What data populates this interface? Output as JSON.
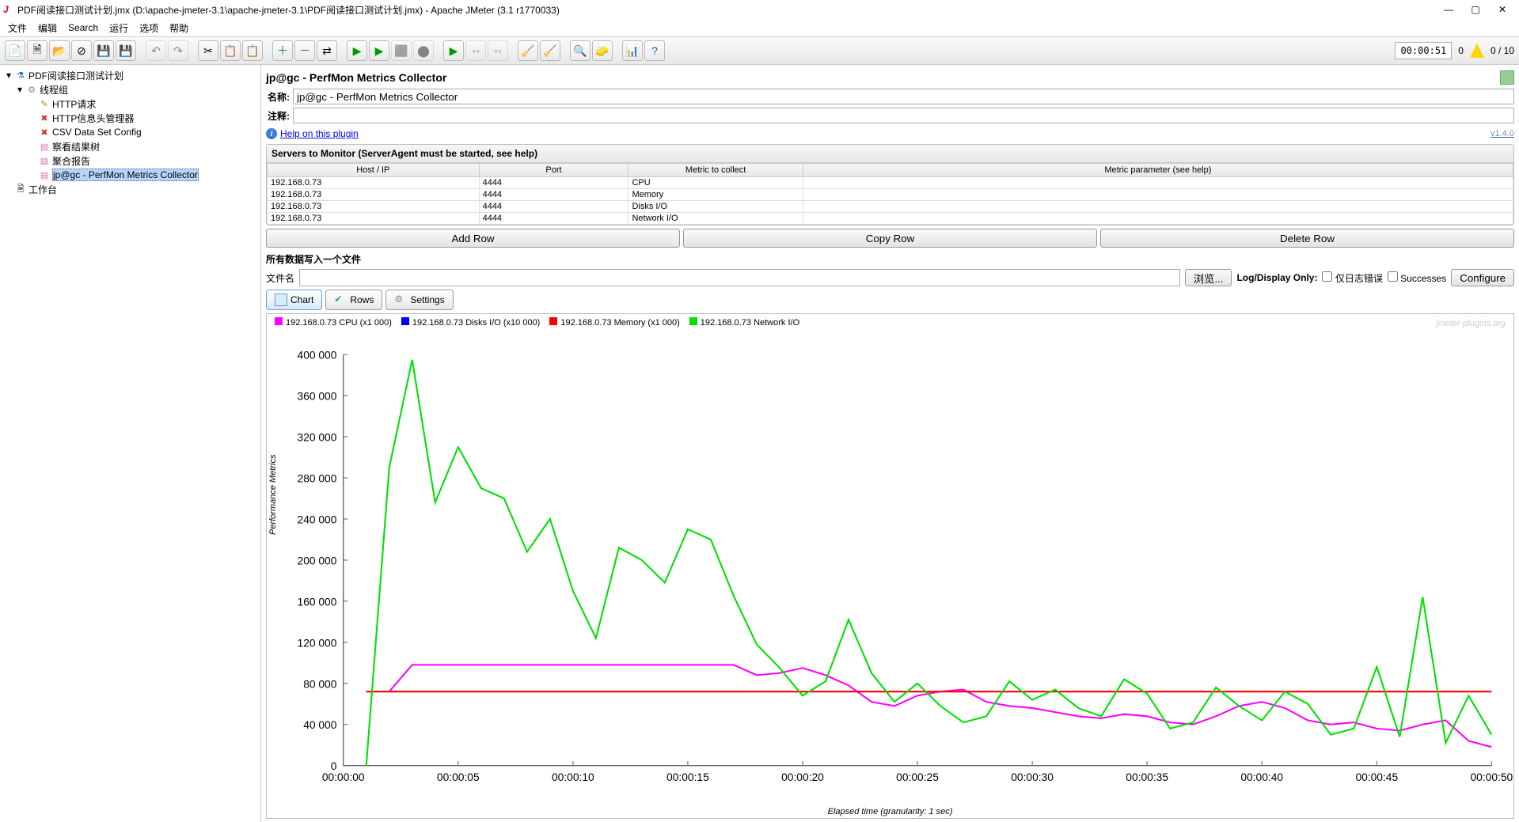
{
  "window": {
    "title": "PDF阅读接口测试计划.jmx (D:\\apache-jmeter-3.1\\apache-jmeter-3.1\\PDF阅读接口测试计划.jmx) - Apache JMeter (3.1 r1770033)"
  },
  "menubar": [
    "文件",
    "编辑",
    "Search",
    "运行",
    "选项",
    "帮助"
  ],
  "toolbar_right": {
    "timer": "00:00:51",
    "warn_count": "0",
    "threads": "0 / 10"
  },
  "tree": {
    "root": "PDF阅读接口测试计划",
    "threadgroup": "线程组",
    "items": [
      "HTTP请求",
      "HTTP信息头管理器",
      "CSV Data Set Config",
      "察看结果树",
      "聚合报告",
      "jp@gc - PerfMon Metrics Collector"
    ],
    "workbench": "工作台"
  },
  "page": {
    "title": "jp@gc - PerfMon Metrics Collector",
    "name_label": "名称:",
    "name_value": "jp@gc - PerfMon Metrics Collector",
    "comment_label": "注释:",
    "help_link": "Help on this plugin",
    "version": "v1.4.0"
  },
  "servers_panel": {
    "title": "Servers to Monitor (ServerAgent must be started, see help)",
    "columns": [
      "Host / IP",
      "Port",
      "Metric to collect",
      "Metric parameter (see help)"
    ],
    "rows": [
      {
        "host": "192.168.0.73",
        "port": "4444",
        "metric": "CPU",
        "param": ""
      },
      {
        "host": "192.168.0.73",
        "port": "4444",
        "metric": "Memory",
        "param": ""
      },
      {
        "host": "192.168.0.73",
        "port": "4444",
        "metric": "Disks I/O",
        "param": ""
      },
      {
        "host": "192.168.0.73",
        "port": "4444",
        "metric": "Network I/O",
        "param": ""
      }
    ],
    "buttons": {
      "add": "Add Row",
      "copy": "Copy Row",
      "delete": "Delete Row"
    }
  },
  "file_section": {
    "heading": "所有数据写入一个文件",
    "label": "文件名",
    "browse": "浏览...",
    "logonly": "Log/Display Only:",
    "errors": "仅日志错误",
    "successes": "Successes",
    "configure": "Configure"
  },
  "tabs": {
    "chart": "Chart",
    "rows": "Rows",
    "settings": "Settings"
  },
  "legend": [
    {
      "color": "#ff00ff",
      "label": "192.168.0.73 CPU (x1 000)"
    },
    {
      "color": "#0000ff",
      "label": "192.168.0.73 Disks I/O (x10 000)"
    },
    {
      "color": "#ff0000",
      "label": "192.168.0.73 Memory (x1 000)"
    },
    {
      "color": "#00e000",
      "label": "192.168.0.73 Network I/O"
    }
  ],
  "watermark": "jmeter-plugins.org",
  "axis": {
    "ylabel": "Performance Metrics",
    "xlabel": "Elapsed time (granularity: 1 sec)",
    "yticks": [
      "0",
      "40 000",
      "80 000",
      "120 000",
      "160 000",
      "200 000",
      "240 000",
      "280 000",
      "320 000",
      "360 000",
      "400 000"
    ],
    "xticks": [
      "00:00:00",
      "00:00:05",
      "00:00:10",
      "00:00:15",
      "00:00:20",
      "00:00:25",
      "00:00:30",
      "00:00:35",
      "00:00:40",
      "00:00:45",
      "00:00:50"
    ]
  },
  "chart_data": {
    "type": "line",
    "xlabel": "Elapsed time (granularity: 1 sec)",
    "ylabel": "Performance Metrics",
    "ylim": [
      0,
      400000
    ],
    "x": [
      0,
      1,
      2,
      3,
      4,
      5,
      6,
      7,
      8,
      9,
      10,
      11,
      12,
      13,
      14,
      15,
      16,
      17,
      18,
      19,
      20,
      21,
      22,
      23,
      24,
      25,
      26,
      27,
      28,
      29,
      30,
      31,
      32,
      33,
      34,
      35,
      36,
      37,
      38,
      39,
      40,
      41,
      42,
      43,
      44,
      45,
      46,
      47,
      48,
      49,
      50
    ],
    "series": [
      {
        "name": "192.168.0.73 CPU (x1 000)",
        "color": "#ff00ff",
        "values": [
          null,
          null,
          72000,
          98000,
          98000,
          98000,
          98000,
          98000,
          98000,
          98000,
          98000,
          98000,
          98000,
          98000,
          98000,
          98000,
          98000,
          98000,
          88000,
          90000,
          95000,
          88000,
          78000,
          62000,
          58000,
          68000,
          72000,
          74000,
          62000,
          58000,
          56000,
          52000,
          48000,
          46000,
          50000,
          48000,
          42000,
          40000,
          48000,
          58000,
          62000,
          56000,
          44000,
          40000,
          42000,
          36000,
          34000,
          40000,
          44000,
          24000,
          18000
        ]
      },
      {
        "name": "192.168.0.73 Disks I/O (x10 000)",
        "color": "#0000ff",
        "values": [
          null,
          null,
          null,
          null,
          null,
          null,
          null,
          null,
          null,
          null,
          null,
          null,
          null,
          null,
          null,
          null,
          null,
          null,
          null,
          null,
          null,
          null,
          null,
          null,
          null,
          null,
          null,
          null,
          null,
          null,
          null,
          null,
          null,
          null,
          null,
          null,
          null,
          null,
          null,
          null,
          null,
          null,
          null,
          null,
          null,
          null,
          null,
          null,
          null,
          null,
          null
        ]
      },
      {
        "name": "192.168.0.73 Memory (x1 000)",
        "color": "#ff0000",
        "values": [
          null,
          72000,
          72000,
          72000,
          72000,
          72000,
          72000,
          72000,
          72000,
          72000,
          72000,
          72000,
          72000,
          72000,
          72000,
          72000,
          72000,
          72000,
          72000,
          72000,
          72000,
          72000,
          72000,
          72000,
          72000,
          72000,
          72000,
          72000,
          72000,
          72000,
          72000,
          72000,
          72000,
          72000,
          72000,
          72000,
          72000,
          72000,
          72000,
          72000,
          72000,
          72000,
          72000,
          72000,
          72000,
          72000,
          72000,
          72000,
          72000,
          72000,
          72000
        ]
      },
      {
        "name": "192.168.0.73 Network I/O",
        "color": "#00e000",
        "values": [
          null,
          0,
          290000,
          395000,
          256000,
          310000,
          270000,
          260000,
          208000,
          240000,
          170000,
          124000,
          212000,
          200000,
          178000,
          230000,
          220000,
          165000,
          118000,
          95000,
          68000,
          82000,
          142000,
          90000,
          62000,
          80000,
          58000,
          42000,
          48000,
          82000,
          64000,
          74000,
          56000,
          48000,
          84000,
          70000,
          36000,
          42000,
          76000,
          58000,
          44000,
          72000,
          60000,
          30000,
          36000,
          96000,
          28000,
          164000,
          22000,
          68000,
          30000
        ]
      }
    ]
  }
}
